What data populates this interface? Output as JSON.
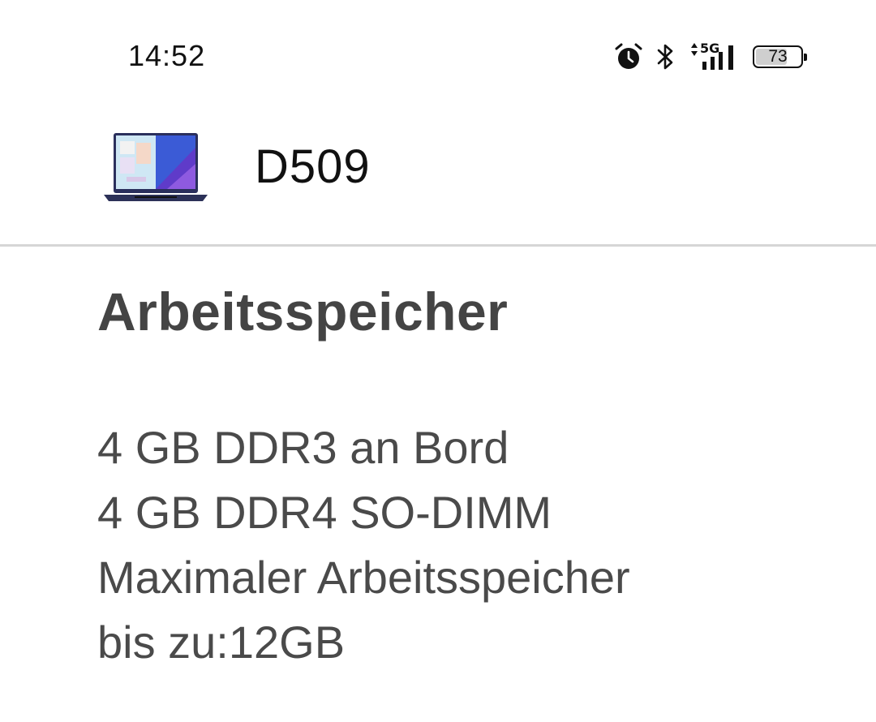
{
  "status_bar": {
    "time": "14:52",
    "network": "5G",
    "battery_level": 73,
    "battery_label": "73",
    "icons": [
      "alarm-icon",
      "bluetooth-icon",
      "data-transfer-icon",
      "signal-icon",
      "battery-icon"
    ]
  },
  "product": {
    "name": "D509",
    "thumbnail": "laptop-thumbnail"
  },
  "section": {
    "title": "Arbeitsspeicher",
    "lines": [
      "4 GB DDR3 an Bord",
      "4 GB DDR4 SO-DIMM",
      "Maximaler Arbeitsspeicher",
      "bis zu:12GB"
    ]
  },
  "colors": {
    "background": "#ffffff",
    "divider": "#d6d6d6",
    "title_text": "#444444",
    "body_text": "#4a4a4a"
  }
}
